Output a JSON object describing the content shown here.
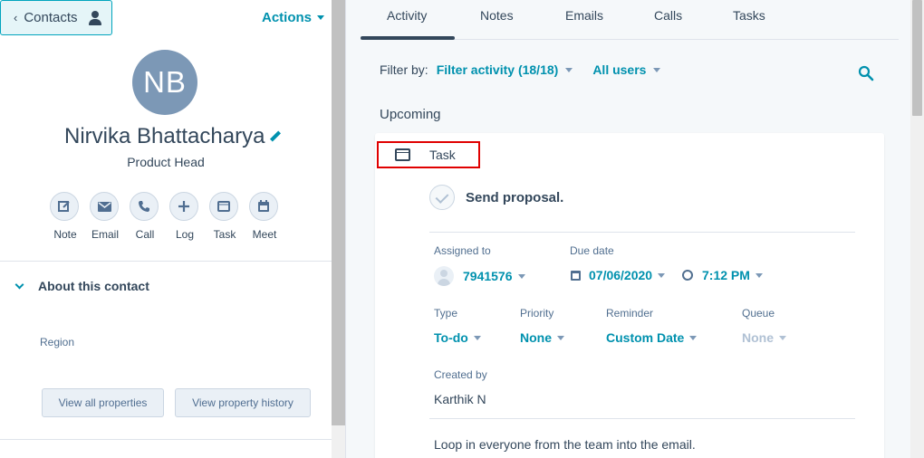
{
  "contact_header": {
    "back_label": "Contacts",
    "actions_label": "Actions"
  },
  "profile": {
    "initials": "NB",
    "name": "Nirvika Bhattacharya",
    "job_title": "Product Head"
  },
  "quick_actions": [
    {
      "label": "Note",
      "icon": "note-icon"
    },
    {
      "label": "Email",
      "icon": "email-icon"
    },
    {
      "label": "Call",
      "icon": "call-icon"
    },
    {
      "label": "Log",
      "icon": "plus-icon"
    },
    {
      "label": "Task",
      "icon": "task-icon"
    },
    {
      "label": "Meet",
      "icon": "calendar-icon"
    }
  ],
  "about": {
    "heading": "About this contact",
    "region_label": "Region",
    "view_all_label": "View all properties",
    "view_history_label": "View property history"
  },
  "tabs": [
    "Activity",
    "Notes",
    "Emails",
    "Calls",
    "Tasks"
  ],
  "active_tab": "Activity",
  "filter": {
    "label": "Filter by:",
    "activity": "Filter activity (18/18)",
    "users": "All users"
  },
  "section_title": "Upcoming",
  "task": {
    "type_header": "Task",
    "subject": "Send proposal.",
    "assigned_to_label": "Assigned to",
    "assigned_to": "7941576",
    "due_date_label": "Due date",
    "due_date": "07/06/2020",
    "due_time": "7:12 PM",
    "type_label": "Type",
    "type": "To-do",
    "priority_label": "Priority",
    "priority": "None",
    "reminder_label": "Reminder",
    "reminder": "Custom Date",
    "queue_label": "Queue",
    "queue": "None",
    "created_by_label": "Created by",
    "created_by": "Karthik N",
    "notes": "Loop in everyone from the team into the email."
  },
  "colors": {
    "accent": "#0091ae",
    "highlight_border": "#e00000",
    "avatar_bg": "#7c98b6"
  }
}
